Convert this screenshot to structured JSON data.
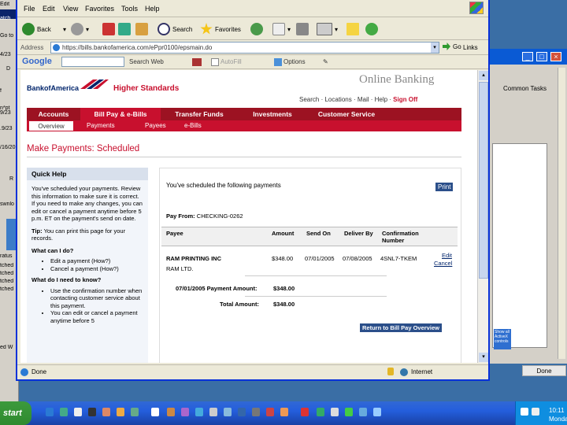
{
  "background": {
    "left_fragments": [
      "Edit",
      "atch",
      "Go to",
      "4/23",
      "D",
      "f",
      "n*pt",
      "9/23",
      ".9/23",
      "/16/20",
      "R",
      "swnlo",
      "ratus",
      "tched",
      "tched",
      "tched",
      "tched",
      "ed W"
    ],
    "right_window": {
      "task_label": "Common Tasks",
      "mini_tile_text": "Show all ActiveX controls",
      "done_label": "Done"
    }
  },
  "browser": {
    "menu": [
      "File",
      "Edit",
      "View",
      "Favorites",
      "Tools",
      "Help"
    ],
    "toolbar": {
      "back": "Back",
      "search": "Search",
      "favorites": "Favorites"
    },
    "address": {
      "label": "Address",
      "url": "https://bills.bankofamerica.com/ePpr0100/epsmain.do",
      "go": "Go",
      "links": "Links"
    },
    "google": {
      "logo": "Google",
      "search_web": "Search Web",
      "autofill": "AutoFill",
      "options": "Options"
    },
    "status": {
      "text": "Done",
      "zone": "Internet"
    }
  },
  "site": {
    "logo": "BankofAmerica",
    "tagline": "Higher Standards",
    "section": "Online Banking",
    "util_nav": [
      "Search",
      "Locations",
      "Mail",
      "Help"
    ],
    "sign_off": "Sign Off",
    "main_nav": [
      "Accounts",
      "Bill Pay & e-Bills",
      "Transfer Funds",
      "Investments",
      "Customer Service"
    ],
    "sub_nav": [
      "Overview",
      "Payments",
      "Payees",
      "e-Bills"
    ],
    "page_title": "Make Payments: Scheduled"
  },
  "quick_help": {
    "heading": "Quick Help",
    "para1": "You've scheduled your payments. Review this information to make sure it is correct. If you need to make any changes, you can edit or cancel a payment anytime before 5 p.m. ET on the payment's send on date.",
    "tip_label": "Tip:",
    "tip": "You can print this page for your records.",
    "q1": "What can I do?",
    "q1_items": [
      "Edit a payment (How?)",
      "Cancel a payment (How?)"
    ],
    "q2": "What do I need to know?",
    "q2_items": [
      "Use the confirmation number when contacting customer service about this payment.",
      "You can edit or cancel a payment anytime before 5"
    ]
  },
  "payments": {
    "intro": "You've scheduled the following payments",
    "print": "Print",
    "pay_from_label": "Pay From:",
    "pay_from_account": "CHECKING-0262",
    "headers": [
      "Payee",
      "Amount",
      "Send On",
      "Deliver By",
      "Confirmation Number"
    ],
    "rows": [
      {
        "payee": "RAM PRINTING INC",
        "payee_sub": "RAM LTD.",
        "amount": "$348.00",
        "send_on": "07/01/2005",
        "deliver_by": "07/08/2005",
        "confirmation": "4SNL7-TKEM",
        "edit": "Edit",
        "cancel": "Cancel"
      }
    ],
    "date_total_label": "07/01/2005 Payment Amount:",
    "date_total": "$348.00",
    "total_label": "Total Amount:",
    "total": "$348.00",
    "return_button": "Return to Bill Pay Overview"
  },
  "taskbar": {
    "start": "start",
    "time": "10:11",
    "day": "Monday"
  },
  "colors": {
    "boa_navy": "#00246b",
    "boa_red": "#c8102e",
    "nav_dark_red": "#9c1222"
  }
}
